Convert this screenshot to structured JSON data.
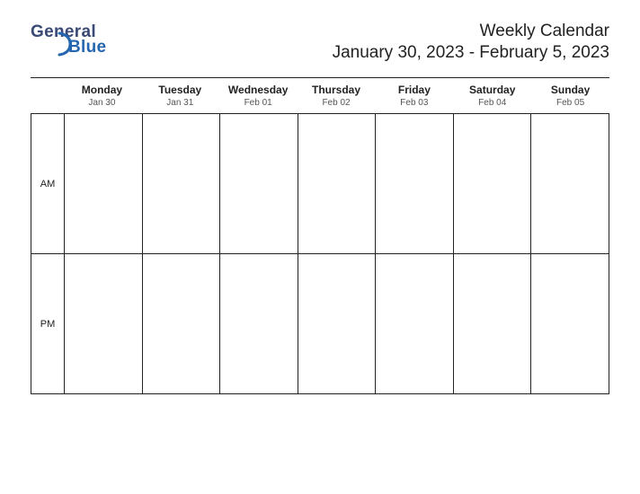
{
  "logo": {
    "line1": "General",
    "line2": "Blue"
  },
  "heading": {
    "title": "Weekly Calendar",
    "range": "January 30, 2023 - February 5, 2023"
  },
  "days": [
    {
      "name": "Monday",
      "date": "Jan 30"
    },
    {
      "name": "Tuesday",
      "date": "Jan 31"
    },
    {
      "name": "Wednesday",
      "date": "Feb 01"
    },
    {
      "name": "Thursday",
      "date": "Feb 02"
    },
    {
      "name": "Friday",
      "date": "Feb 03"
    },
    {
      "name": "Saturday",
      "date": "Feb 04"
    },
    {
      "name": "Sunday",
      "date": "Feb 05"
    }
  ],
  "periods": [
    {
      "label": "AM"
    },
    {
      "label": "PM"
    }
  ]
}
